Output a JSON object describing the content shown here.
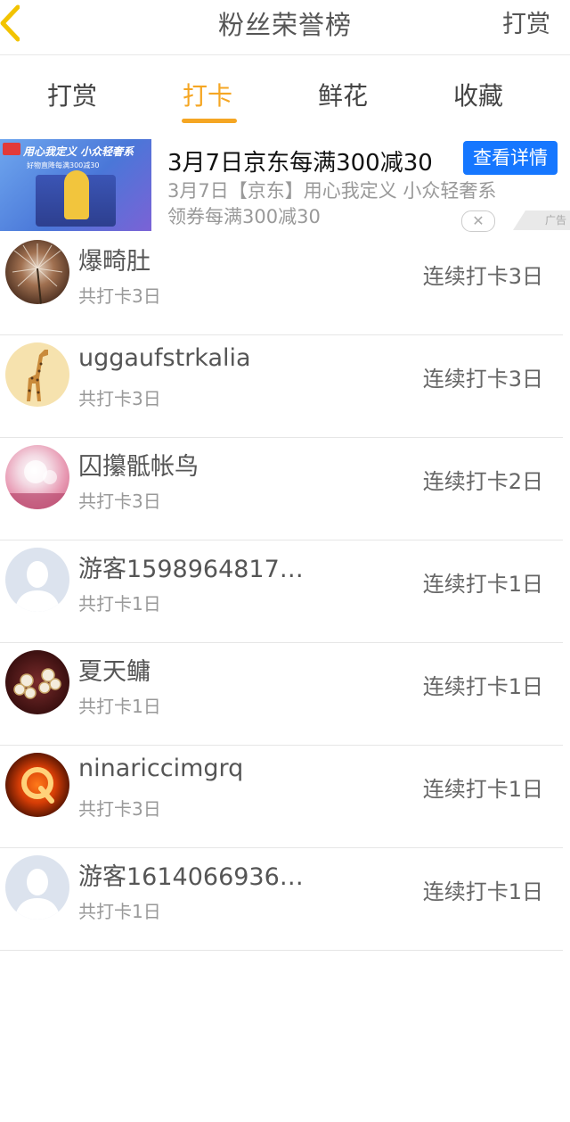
{
  "nav": {
    "title": "粉丝荣誉榜",
    "action": "打赏"
  },
  "tabs": [
    {
      "label": "打赏",
      "active": false
    },
    {
      "label": "打卡",
      "active": true
    },
    {
      "label": "鲜花",
      "active": false
    },
    {
      "label": "收藏",
      "active": false
    }
  ],
  "ad": {
    "image_text": "用心我定义 小众轻奢系",
    "image_subtext": "好物直降每满300减30",
    "title": "3月7日京东每满300减30",
    "button": "查看详情",
    "desc_line1": "3月7日【京东】用心我定义 小众轻奢系",
    "desc_line2": "领券每满300减30",
    "close": "✕",
    "tag": "广告"
  },
  "colors": {
    "accent": "#f5a623",
    "ad_button": "#1677ff"
  },
  "users": [
    {
      "name": "爆畸肚",
      "total": "共打卡3日",
      "streak": "连续打卡3日",
      "avatar": "dandelion"
    },
    {
      "name": "uggaufstrkalia",
      "total": "共打卡3日",
      "streak": "连续打卡3日",
      "avatar": "giraffe"
    },
    {
      "name": "囚攥骶帐鸟",
      "total": "共打卡3日",
      "streak": "连续打卡2日",
      "avatar": "pink"
    },
    {
      "name": "游客1598964817…",
      "total": "共打卡1日",
      "streak": "连续打卡1日",
      "avatar": "default"
    },
    {
      "name": "夏天鳙",
      "total": "共打卡1日",
      "streak": "连续打卡1日",
      "avatar": "pearl"
    },
    {
      "name": "ninariccimgrq",
      "total": "共打卡3日",
      "streak": "连续打卡1日",
      "avatar": "fire"
    },
    {
      "name": "游客1614066936…",
      "total": "共打卡1日",
      "streak": "连续打卡1日",
      "avatar": "default"
    }
  ]
}
